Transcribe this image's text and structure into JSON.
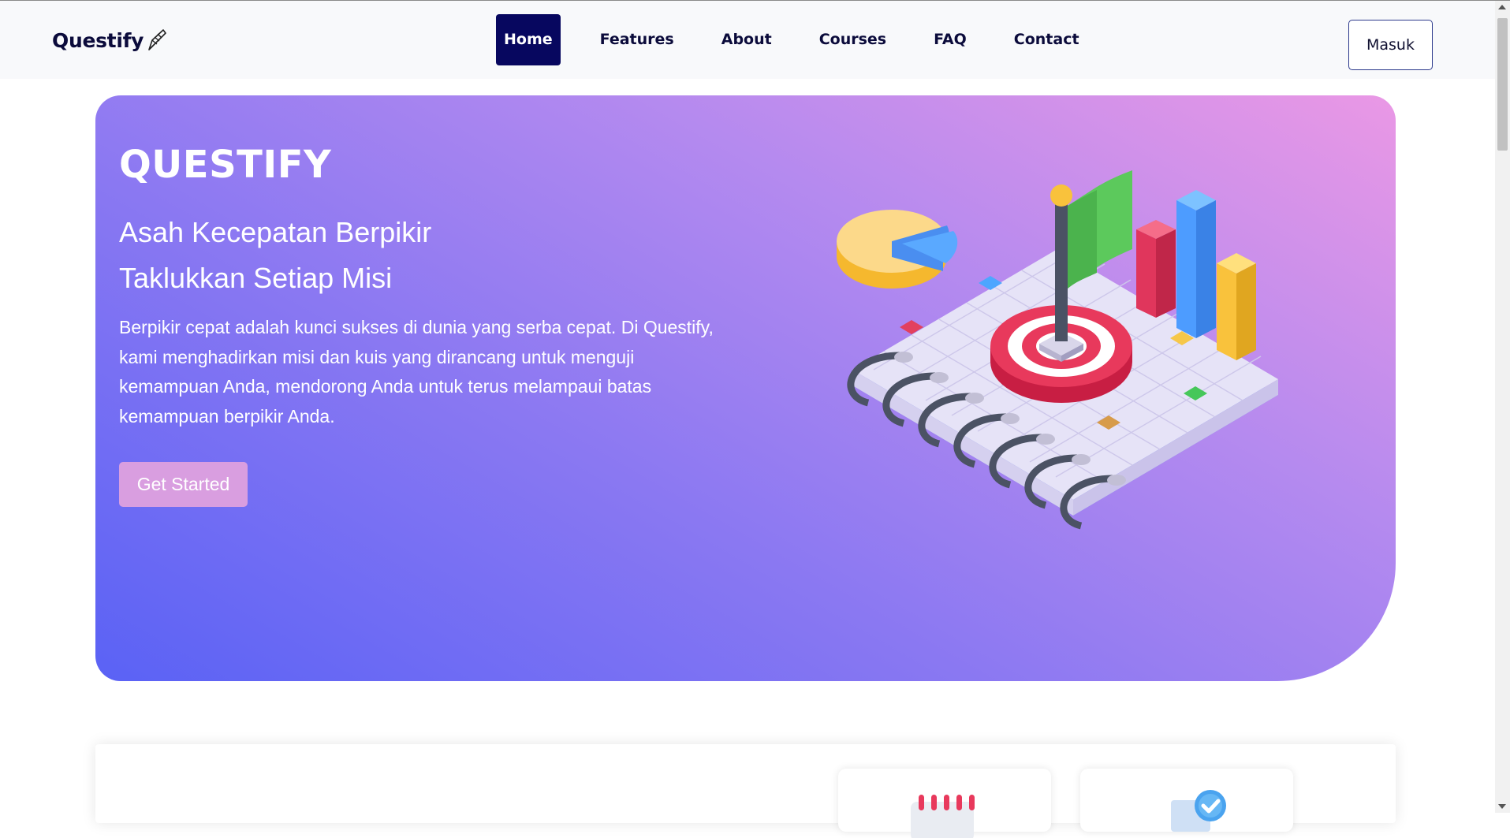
{
  "brand": {
    "name": "Questify",
    "logo_icon": "feather-pen-icon"
  },
  "nav": {
    "items": [
      {
        "label": "Home",
        "active": true
      },
      {
        "label": "Features",
        "active": false
      },
      {
        "label": "About",
        "active": false
      },
      {
        "label": "Courses",
        "active": false
      },
      {
        "label": "FAQ",
        "active": false
      },
      {
        "label": "Contact",
        "active": false
      }
    ],
    "login_label": "Masuk"
  },
  "hero": {
    "title": "QUESTIFY",
    "subtitle_line1": "Asah Kecepatan Berpikir",
    "subtitle_line2": "Taklukkan Setiap Misi",
    "description": "Berpikir cepat adalah kunci sukses di dunia yang serba cepat. Di Questify, kami menghadirkan misi dan kuis yang dirancang untuk menguji kemampuan Anda, mendorong Anda untuk terus melampaui batas kemampuan berpikir Anda.",
    "cta_label": "Get Started",
    "illustration": "notebook-target-flag-charts-illustration"
  },
  "features": {
    "cards": [
      {
        "icon": "calendar-icon"
      },
      {
        "icon": "checkmark-badge-icon"
      }
    ]
  },
  "colors": {
    "nav_active_bg": "#07075f",
    "brand_text": "#0b0b3b",
    "hero_gradient_start": "#5a62f5",
    "hero_gradient_end": "#ea98e5",
    "cta_bg": "#d99ee0"
  }
}
